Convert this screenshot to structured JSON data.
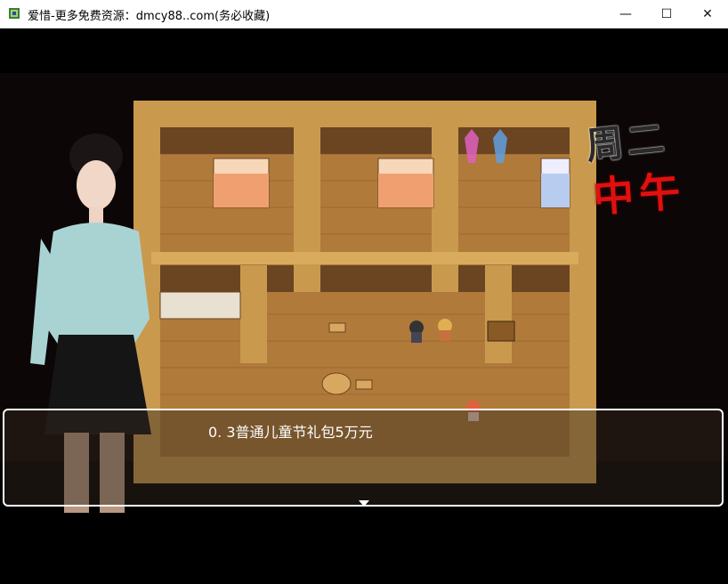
{
  "window": {
    "title": "爱惜-更多免费资源：dmcy88..com(务必收藏)",
    "icon": "game-app-icon",
    "controls": {
      "minimize": "—",
      "maximize": "☐",
      "close": "✕"
    }
  },
  "hud": {
    "day": "周二",
    "time_of_day": "中午",
    "time_color": "#e01010"
  },
  "dialog": {
    "text": "0. 3普通儿童节礼包5万元",
    "continue_icon": "continue-arrow-icon"
  },
  "map": {
    "location_type": "wooden house interior",
    "objects": [
      "bed",
      "bed",
      "bed",
      "pink-crystal",
      "blue-crystal",
      "kitchen-counter",
      "table",
      "stool",
      "barrel",
      "npc-dark-hair",
      "npc-blonde",
      "npc-red-hair"
    ]
  },
  "colors": {
    "floor": "#b07a3a",
    "wall": "#c99a4e",
    "frame": "#ffffff"
  }
}
